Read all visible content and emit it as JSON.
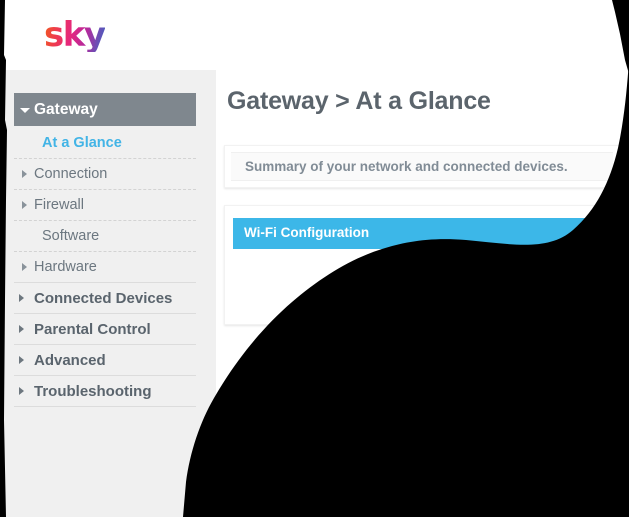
{
  "brand": {
    "logo_text": "sky"
  },
  "sidebar": {
    "group": {
      "label": "Gateway",
      "expanded_icon": "caret-down-icon"
    },
    "items": [
      {
        "label": "At a Glance",
        "state": "active",
        "icon": null
      },
      {
        "label": "Connection",
        "state": "collapsed",
        "icon": "caret-right-icon"
      },
      {
        "label": "Firewall",
        "state": "collapsed",
        "icon": "caret-right-icon"
      },
      {
        "label": "Software",
        "state": "normal",
        "icon": null
      },
      {
        "label": "Hardware",
        "state": "collapsed",
        "icon": "caret-right-icon"
      }
    ],
    "sections": [
      {
        "label": "Connected Devices",
        "icon": "caret-right-icon"
      },
      {
        "label": "Parental Control",
        "icon": "caret-right-icon"
      },
      {
        "label": "Advanced",
        "icon": "caret-right-icon"
      },
      {
        "label": "Troubleshooting",
        "icon": "caret-right-icon"
      }
    ]
  },
  "main": {
    "title": "Gateway > At a Glance",
    "summary": "Summary of your network and connected devices.",
    "wifi_section_title": "Wi-Fi Configuration"
  },
  "colors": {
    "accent_blue": "#3cb7e8",
    "link_blue": "#42b4e6",
    "group_header_bg": "#7f878e",
    "sidebar_bg": "#f0f0f0",
    "text_gray": "#6c7780",
    "title_gray": "#5b646c",
    "occlusion": "#000000"
  }
}
